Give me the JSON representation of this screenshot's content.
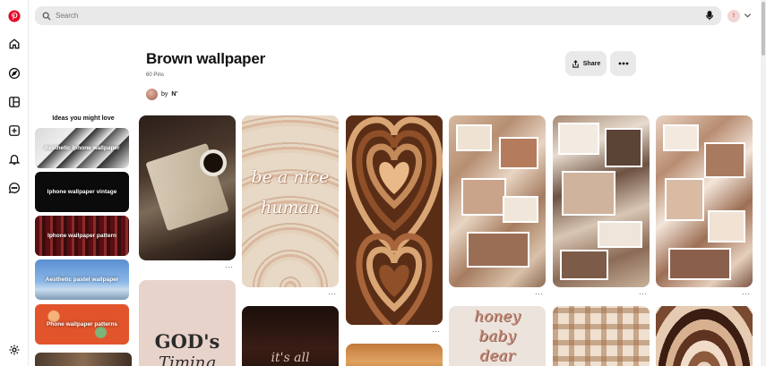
{
  "search": {
    "placeholder": "Search"
  },
  "profile": {
    "initial": "!"
  },
  "board": {
    "title": "Brown wallpaper",
    "pin_count": "60 Pins",
    "by_label": "by",
    "owner": "N'",
    "share_label": "Share"
  },
  "ideas": {
    "title": "Ideas you might love",
    "items": [
      {
        "label": "Aesthetic iphone wallpaper"
      },
      {
        "label": "Iphone wallpaper vintage"
      },
      {
        "label": "Iphone wallpaper pattern"
      },
      {
        "label": "Aesthetic pastel wallpaper"
      },
      {
        "label": "Phone wallpaper patterns"
      }
    ]
  },
  "pins": {
    "rainbow_text_1": "be a nice",
    "rainbow_text_2": "human",
    "gods_text_1": "GOD's",
    "gods_text_2": "Timing",
    "honey_text_1": "honey",
    "honey_text_2": "baby",
    "honey_text_3": "dear",
    "script_text": "it's all"
  },
  "icons": {
    "logo": "pinterest-logo-icon",
    "home": "home-icon",
    "explore": "compass-icon",
    "boards": "dashboard-icon",
    "create": "plus-square-icon",
    "notifications": "bell-icon",
    "messages": "chat-icon",
    "settings": "gear-icon"
  },
  "colors": {
    "brand": "#e60023",
    "button_bg": "#e9e9e9"
  }
}
